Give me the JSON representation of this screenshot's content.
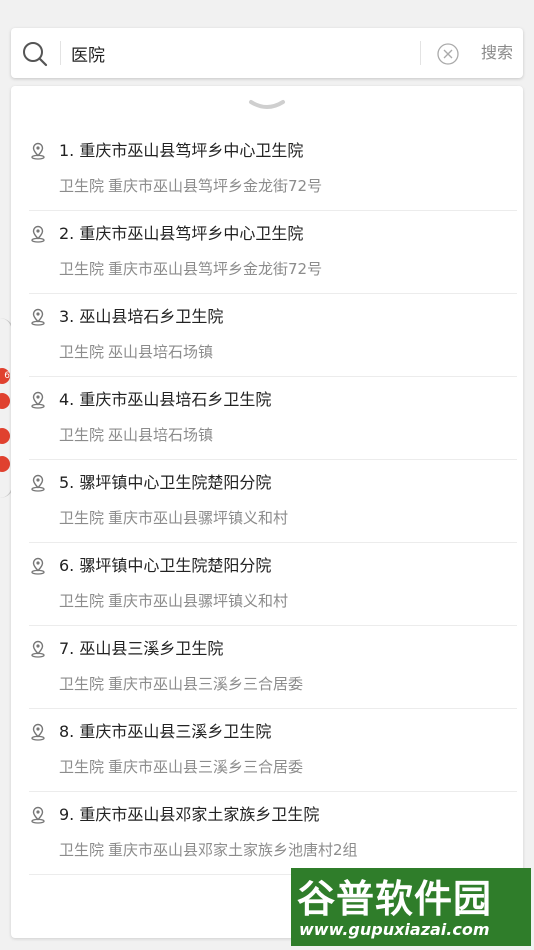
{
  "map": {
    "badge_text": "6"
  },
  "search": {
    "query": "医院",
    "button_label": "搜索"
  },
  "results": [
    {
      "title": "1. 重庆市巫山县笃坪乡中心卫生院",
      "category": "卫生院",
      "address": "重庆市巫山县笃坪乡金龙街72号"
    },
    {
      "title": "2. 重庆市巫山县笃坪乡中心卫生院",
      "category": "卫生院",
      "address": "重庆市巫山县笃坪乡金龙街72号"
    },
    {
      "title": "3. 巫山县培石乡卫生院",
      "category": "卫生院",
      "address": "巫山县培石场镇"
    },
    {
      "title": "4. 重庆市巫山县培石乡卫生院",
      "category": "卫生院",
      "address": "巫山县培石场镇"
    },
    {
      "title": "5. 骡坪镇中心卫生院楚阳分院",
      "category": "卫生院",
      "address": "重庆市巫山县骡坪镇义和村"
    },
    {
      "title": "6. 骡坪镇中心卫生院楚阳分院",
      "category": "卫生院",
      "address": "重庆市巫山县骡坪镇义和村"
    },
    {
      "title": "7. 巫山县三溪乡卫生院",
      "category": "卫生院",
      "address": "重庆市巫山县三溪乡三合居委"
    },
    {
      "title": "8. 重庆市巫山县三溪乡卫生院",
      "category": "卫生院",
      "address": "重庆市巫山县三溪乡三合居委"
    },
    {
      "title": "9. 重庆市巫山县邓家土家族乡卫生院",
      "category": "卫生院",
      "address": "重庆市巫山县邓家土家族乡池唐村2组"
    }
  ],
  "watermark": {
    "brand": "谷普软件园",
    "url": "www.gupuxiazai.com"
  },
  "colors": {
    "pin": "#e0412f",
    "watermark_bg": "#2f7d2a"
  },
  "icons": {
    "search": "search-icon",
    "clear": "clear-icon",
    "result": "location-pin-icon",
    "handle": "chevron-down-icon"
  }
}
